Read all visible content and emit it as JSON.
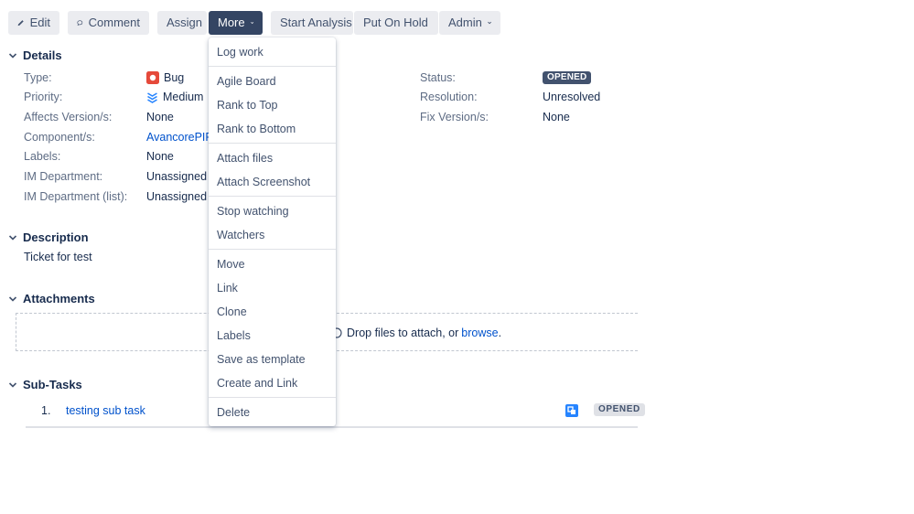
{
  "toolbar": {
    "edit": "Edit",
    "comment": "Comment",
    "assign": "Assign",
    "more": "More",
    "start_analysis": "Start Analysis",
    "put_on_hold": "Put On Hold",
    "admin": "Admin"
  },
  "details": {
    "title": "Details",
    "type_label": "Type:",
    "type_value": "Bug",
    "priority_label": "Priority:",
    "priority_value": "Medium",
    "affects_label": "Affects Version/s:",
    "affects_value": "None",
    "component_label": "Component/s:",
    "component_value": "AvancorePIF",
    "labels_label": "Labels:",
    "labels_value": "None",
    "im_dept_label": "IM Department:",
    "im_dept_value": "Unassigned",
    "im_dept_list_label": "IM Department (list):",
    "im_dept_list_value": "Unassigned",
    "status_label": "Status:",
    "status_value": "OPENED",
    "resolution_label": "Resolution:",
    "resolution_value": "Unresolved",
    "fix_label": "Fix Version/s:",
    "fix_value": "None"
  },
  "description": {
    "title": "Description",
    "text": "Ticket for test"
  },
  "attachments": {
    "title": "Attachments",
    "drop_text": "Drop files to attach, or",
    "browse": "browse",
    "period": "."
  },
  "subtasks": {
    "title": "Sub-Tasks",
    "items": [
      {
        "num": "1.",
        "name": "testing sub task",
        "status": "OPENED"
      }
    ]
  },
  "more_menu": {
    "log_work": "Log work",
    "agile_board": "Agile Board",
    "rank_top": "Rank to Top",
    "rank_bottom": "Rank to Bottom",
    "attach_files": "Attach files",
    "attach_screenshot": "Attach Screenshot",
    "stop_watching": "Stop watching",
    "watchers": "Watchers",
    "move": "Move",
    "link": "Link",
    "clone": "Clone",
    "labels": "Labels",
    "save_template": "Save as template",
    "create_link": "Create and Link",
    "delete": "Delete"
  },
  "colors": {
    "bug": "#e5493a",
    "priority": "#2684ff",
    "link": "#0052cc",
    "more_active": "#344563",
    "status_dark": "#42526e"
  }
}
